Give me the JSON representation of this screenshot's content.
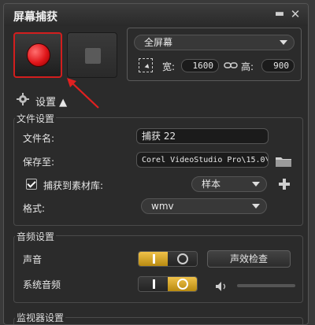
{
  "window": {
    "title": "屏幕捕获",
    "minimize_glyph": "▬",
    "close_glyph": "✕"
  },
  "capture_area": {
    "mode": "全屏幕",
    "width_label": "宽:",
    "width_value": "1600",
    "height_label": "高:",
    "height_value": "900"
  },
  "settings_toggle": {
    "label": "设置 ▲"
  },
  "file_settings": {
    "title": "文件设置",
    "filename_label": "文件名:",
    "filename_value": "捕获 22",
    "save_to_label": "保存至:",
    "save_to_value": "Corel VideoStudio Pro\\15.0\\",
    "capture_to_library_label": "捕获到素材库:",
    "library_value": "样本",
    "format_label": "格式:",
    "format_value": "wmv"
  },
  "audio_settings": {
    "title": "音频设置",
    "voice_label": "声音",
    "sound_check_label": "声效检查",
    "system_audio_label": "系统音频"
  },
  "monitor_settings": {
    "title": "监视器设置"
  },
  "colors": {
    "accent": "#f0c24a",
    "record": "#e0161a",
    "highlight": "#d21e1e"
  },
  "icons": [
    "record-icon",
    "stop-icon",
    "region-select-icon",
    "link-icon",
    "gear-icon",
    "folder-icon",
    "plus-icon",
    "speaker-icon"
  ]
}
